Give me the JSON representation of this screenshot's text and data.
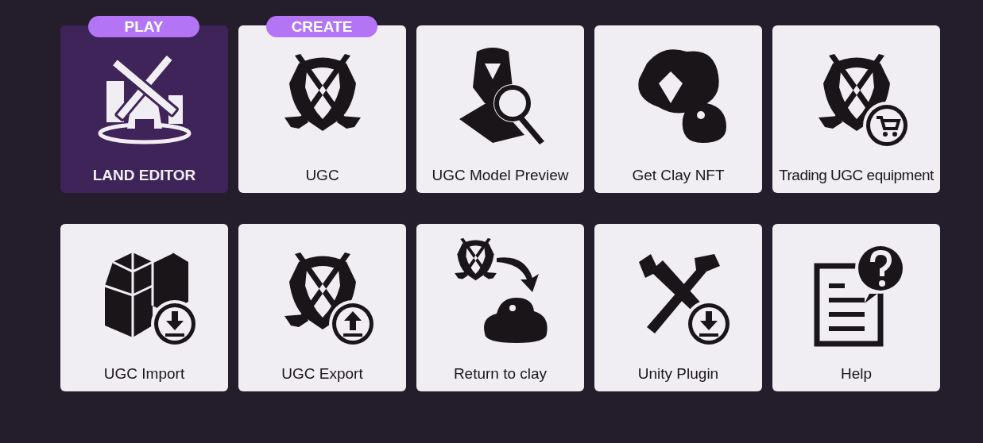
{
  "tiles": [
    {
      "label": "LAND EDITOR",
      "selected": true,
      "badge": "PLAY"
    },
    {
      "label": "UGC",
      "selected": false,
      "badge": "CREATE"
    },
    {
      "label": "UGC Model Preview",
      "selected": false
    },
    {
      "label": "Get Clay NFT",
      "selected": false
    },
    {
      "label": "Trading UGC equipment",
      "selected": false
    },
    {
      "label": "UGC Import",
      "selected": false
    },
    {
      "label": "UGC Export",
      "selected": false
    },
    {
      "label": "Return to clay",
      "selected": false
    },
    {
      "label": "Unity Plugin",
      "selected": false
    },
    {
      "label": "Help",
      "selected": false
    }
  ]
}
